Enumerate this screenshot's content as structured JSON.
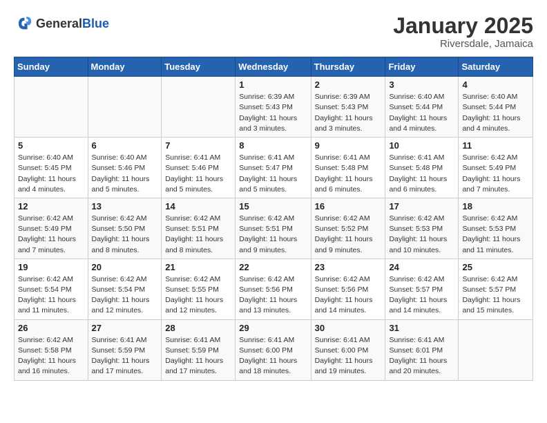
{
  "header": {
    "logo_general": "General",
    "logo_blue": "Blue",
    "month_title": "January 2025",
    "location": "Riversdale, Jamaica"
  },
  "weekdays": [
    "Sunday",
    "Monday",
    "Tuesday",
    "Wednesday",
    "Thursday",
    "Friday",
    "Saturday"
  ],
  "weeks": [
    [
      {
        "day": "",
        "info": ""
      },
      {
        "day": "",
        "info": ""
      },
      {
        "day": "",
        "info": ""
      },
      {
        "day": "1",
        "info": "Sunrise: 6:39 AM\nSunset: 5:43 PM\nDaylight: 11 hours\nand 3 minutes."
      },
      {
        "day": "2",
        "info": "Sunrise: 6:39 AM\nSunset: 5:43 PM\nDaylight: 11 hours\nand 3 minutes."
      },
      {
        "day": "3",
        "info": "Sunrise: 6:40 AM\nSunset: 5:44 PM\nDaylight: 11 hours\nand 4 minutes."
      },
      {
        "day": "4",
        "info": "Sunrise: 6:40 AM\nSunset: 5:44 PM\nDaylight: 11 hours\nand 4 minutes."
      }
    ],
    [
      {
        "day": "5",
        "info": "Sunrise: 6:40 AM\nSunset: 5:45 PM\nDaylight: 11 hours\nand 4 minutes."
      },
      {
        "day": "6",
        "info": "Sunrise: 6:40 AM\nSunset: 5:46 PM\nDaylight: 11 hours\nand 5 minutes."
      },
      {
        "day": "7",
        "info": "Sunrise: 6:41 AM\nSunset: 5:46 PM\nDaylight: 11 hours\nand 5 minutes."
      },
      {
        "day": "8",
        "info": "Sunrise: 6:41 AM\nSunset: 5:47 PM\nDaylight: 11 hours\nand 5 minutes."
      },
      {
        "day": "9",
        "info": "Sunrise: 6:41 AM\nSunset: 5:48 PM\nDaylight: 11 hours\nand 6 minutes."
      },
      {
        "day": "10",
        "info": "Sunrise: 6:41 AM\nSunset: 5:48 PM\nDaylight: 11 hours\nand 6 minutes."
      },
      {
        "day": "11",
        "info": "Sunrise: 6:42 AM\nSunset: 5:49 PM\nDaylight: 11 hours\nand 7 minutes."
      }
    ],
    [
      {
        "day": "12",
        "info": "Sunrise: 6:42 AM\nSunset: 5:49 PM\nDaylight: 11 hours\nand 7 minutes."
      },
      {
        "day": "13",
        "info": "Sunrise: 6:42 AM\nSunset: 5:50 PM\nDaylight: 11 hours\nand 8 minutes."
      },
      {
        "day": "14",
        "info": "Sunrise: 6:42 AM\nSunset: 5:51 PM\nDaylight: 11 hours\nand 8 minutes."
      },
      {
        "day": "15",
        "info": "Sunrise: 6:42 AM\nSunset: 5:51 PM\nDaylight: 11 hours\nand 9 minutes."
      },
      {
        "day": "16",
        "info": "Sunrise: 6:42 AM\nSunset: 5:52 PM\nDaylight: 11 hours\nand 9 minutes."
      },
      {
        "day": "17",
        "info": "Sunrise: 6:42 AM\nSunset: 5:53 PM\nDaylight: 11 hours\nand 10 minutes."
      },
      {
        "day": "18",
        "info": "Sunrise: 6:42 AM\nSunset: 5:53 PM\nDaylight: 11 hours\nand 11 minutes."
      }
    ],
    [
      {
        "day": "19",
        "info": "Sunrise: 6:42 AM\nSunset: 5:54 PM\nDaylight: 11 hours\nand 11 minutes."
      },
      {
        "day": "20",
        "info": "Sunrise: 6:42 AM\nSunset: 5:54 PM\nDaylight: 11 hours\nand 12 minutes."
      },
      {
        "day": "21",
        "info": "Sunrise: 6:42 AM\nSunset: 5:55 PM\nDaylight: 11 hours\nand 12 minutes."
      },
      {
        "day": "22",
        "info": "Sunrise: 6:42 AM\nSunset: 5:56 PM\nDaylight: 11 hours\nand 13 minutes."
      },
      {
        "day": "23",
        "info": "Sunrise: 6:42 AM\nSunset: 5:56 PM\nDaylight: 11 hours\nand 14 minutes."
      },
      {
        "day": "24",
        "info": "Sunrise: 6:42 AM\nSunset: 5:57 PM\nDaylight: 11 hours\nand 14 minutes."
      },
      {
        "day": "25",
        "info": "Sunrise: 6:42 AM\nSunset: 5:57 PM\nDaylight: 11 hours\nand 15 minutes."
      }
    ],
    [
      {
        "day": "26",
        "info": "Sunrise: 6:42 AM\nSunset: 5:58 PM\nDaylight: 11 hours\nand 16 minutes."
      },
      {
        "day": "27",
        "info": "Sunrise: 6:41 AM\nSunset: 5:59 PM\nDaylight: 11 hours\nand 17 minutes."
      },
      {
        "day": "28",
        "info": "Sunrise: 6:41 AM\nSunset: 5:59 PM\nDaylight: 11 hours\nand 17 minutes."
      },
      {
        "day": "29",
        "info": "Sunrise: 6:41 AM\nSunset: 6:00 PM\nDaylight: 11 hours\nand 18 minutes."
      },
      {
        "day": "30",
        "info": "Sunrise: 6:41 AM\nSunset: 6:00 PM\nDaylight: 11 hours\nand 19 minutes."
      },
      {
        "day": "31",
        "info": "Sunrise: 6:41 AM\nSunset: 6:01 PM\nDaylight: 11 hours\nand 20 minutes."
      },
      {
        "day": "",
        "info": ""
      }
    ]
  ]
}
